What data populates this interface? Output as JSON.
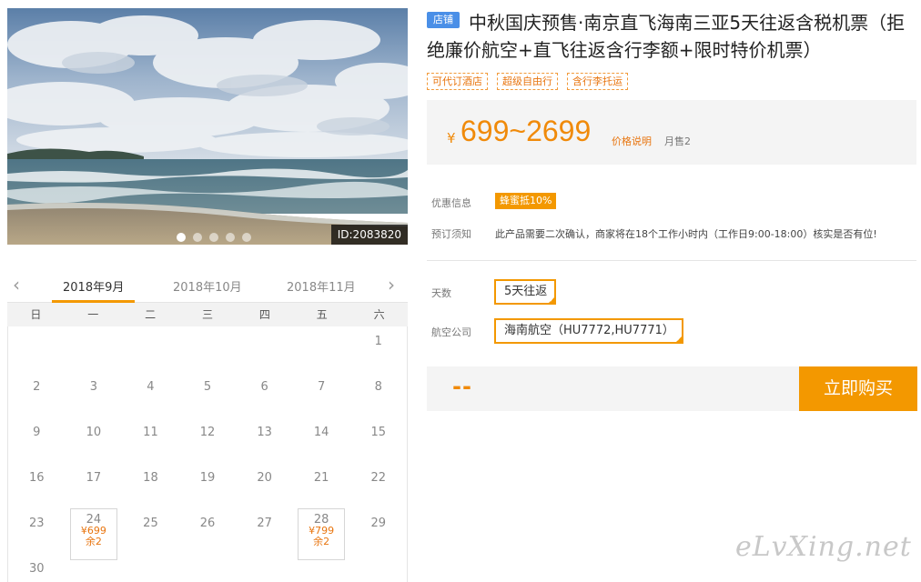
{
  "hero": {
    "id_label": "ID:2083820",
    "slide_count": 5,
    "active_slide": 0
  },
  "calendar": {
    "months": [
      "2018年9月",
      "2018年10月",
      "2018年11月"
    ],
    "active_month": 0,
    "weekdays": [
      "日",
      "一",
      "二",
      "三",
      "四",
      "五",
      "六"
    ],
    "weeks": [
      [
        "",
        "",
        "",
        "",
        "",
        "",
        "1"
      ],
      [
        "2",
        "3",
        "4",
        "5",
        "6",
        "7",
        "8"
      ],
      [
        "9",
        "10",
        "11",
        "12",
        "13",
        "14",
        "15"
      ],
      [
        "16",
        "17",
        "18",
        "19",
        "20",
        "21",
        "22"
      ],
      [
        "23",
        "24",
        "25",
        "26",
        "27",
        "28",
        "29"
      ],
      [
        "30",
        "",
        "",
        "",
        "",
        "",
        ""
      ]
    ],
    "available": {
      "24": {
        "price": "¥699",
        "left": "余2"
      },
      "28": {
        "price": "¥799",
        "left": "余2"
      }
    }
  },
  "product": {
    "store_tag": "店铺",
    "title": "中秋国庆预售·南京直飞海南三亚5天往返含税机票（拒绝廉价航空+直飞往返含行李额+限时特价机票）",
    "tags": [
      "可代订酒店",
      "超级自由行",
      "含行李托运"
    ],
    "currency": "¥",
    "price_range": "699~2699",
    "price_explain": "价格说明",
    "monthly_sales": "月售2"
  },
  "info": {
    "promo_label": "优惠信息",
    "promo_badge": "蜂蜜抵10%",
    "notice_label": "预订须知",
    "notice_text": "此产品需要二次确认，商家将在18个工作小时内（工作日9:00-18:00）核实是否有位!"
  },
  "options": {
    "days_label": "天数",
    "days_value": "5天往返",
    "airline_label": "航空公司",
    "airline_value": "海南航空（HU7772,HU7771）"
  },
  "purchase": {
    "total": "--",
    "buy_label": "立即购买"
  },
  "watermark": "eLvXing.net",
  "colors": {
    "accent": "#f39800",
    "price": "#f08a0a",
    "store_tag": "#4a8fe7"
  }
}
